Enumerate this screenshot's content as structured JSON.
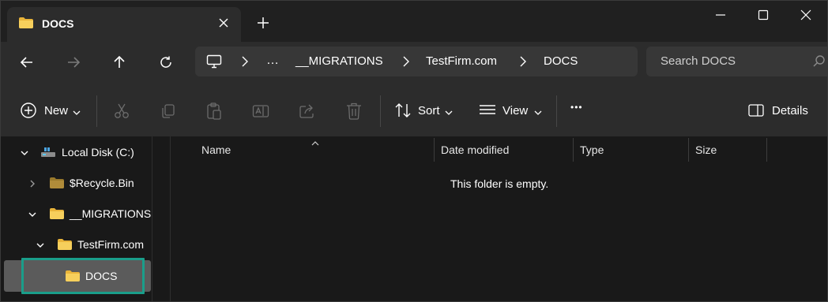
{
  "window": {
    "tab_title": "DOCS",
    "tab_icon": "folder-icon",
    "controls": [
      "minimize-icon",
      "maximize-icon",
      "close-icon"
    ]
  },
  "navigation": {
    "buttons": [
      "back-arrow-icon",
      "forward-arrow-icon",
      "up-arrow-icon",
      "refresh-icon"
    ],
    "address": {
      "root_icon": "this-pc-icon",
      "overflow": "…",
      "crumbs": [
        "__MIGRATIONS",
        "TestFirm.com",
        "DOCS"
      ]
    },
    "search": {
      "placeholder": "Search DOCS"
    }
  },
  "commands": {
    "new_label": "New",
    "sort_label": "Sort",
    "view_label": "View",
    "more": "•••",
    "details_label": "Details",
    "disabled_actions": [
      "cut-icon",
      "copy-icon",
      "paste-icon",
      "rename-icon",
      "share-icon",
      "delete-icon"
    ]
  },
  "tree": {
    "items": [
      {
        "label": "Local Disk (C:)",
        "expanded": true,
        "icon": "drive-icon"
      },
      {
        "label": "$Recycle.Bin",
        "expanded": false,
        "icon": "folder-icon"
      },
      {
        "label": "__MIGRATIONS",
        "expanded": true,
        "icon": "folder-icon"
      },
      {
        "label": "TestFirm.com",
        "expanded": true,
        "icon": "folder-icon"
      },
      {
        "label": "DOCS",
        "selected": true,
        "icon": "folder-icon"
      }
    ]
  },
  "columns": [
    "Name",
    "Date modified",
    "Type",
    "Size"
  ],
  "empty_message": "This folder is empty.",
  "colors": {
    "highlight": "#1a9e8a",
    "folder": "#f0c24a",
    "selected_row": "#5b5b5b"
  }
}
